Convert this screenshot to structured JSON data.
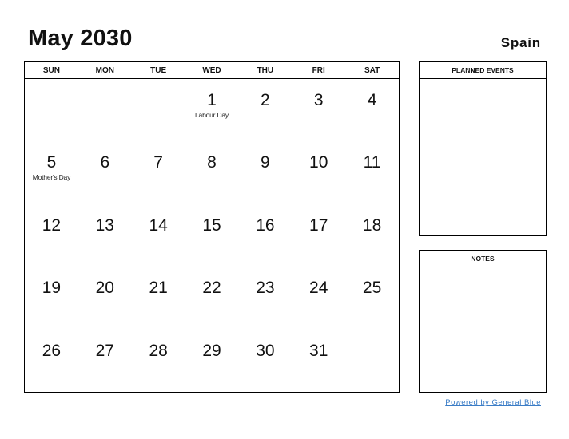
{
  "header": {
    "title": "May 2030",
    "country": "Spain"
  },
  "calendar": {
    "weekdays": [
      "SUN",
      "MON",
      "TUE",
      "WED",
      "THU",
      "FRI",
      "SAT"
    ],
    "weeks": [
      [
        {
          "day": ""
        },
        {
          "day": ""
        },
        {
          "day": ""
        },
        {
          "day": "1",
          "holiday": "Labour Day"
        },
        {
          "day": "2"
        },
        {
          "day": "3"
        },
        {
          "day": "4"
        }
      ],
      [
        {
          "day": "5",
          "holiday": "Mother's Day"
        },
        {
          "day": "6"
        },
        {
          "day": "7"
        },
        {
          "day": "8"
        },
        {
          "day": "9"
        },
        {
          "day": "10"
        },
        {
          "day": "11"
        }
      ],
      [
        {
          "day": "12"
        },
        {
          "day": "13"
        },
        {
          "day": "14"
        },
        {
          "day": "15"
        },
        {
          "day": "16"
        },
        {
          "day": "17"
        },
        {
          "day": "18"
        }
      ],
      [
        {
          "day": "19"
        },
        {
          "day": "20"
        },
        {
          "day": "21"
        },
        {
          "day": "22"
        },
        {
          "day": "23"
        },
        {
          "day": "24"
        },
        {
          "day": "25"
        }
      ],
      [
        {
          "day": "26"
        },
        {
          "day": "27"
        },
        {
          "day": "28"
        },
        {
          "day": "29"
        },
        {
          "day": "30"
        },
        {
          "day": "31"
        },
        {
          "day": ""
        }
      ]
    ]
  },
  "panels": {
    "planned_events": "PLANNED EVENTS",
    "notes": "NOTES"
  },
  "footer": {
    "link_text": "Powered by General Blue",
    "link_color": "#3a7cc6"
  }
}
